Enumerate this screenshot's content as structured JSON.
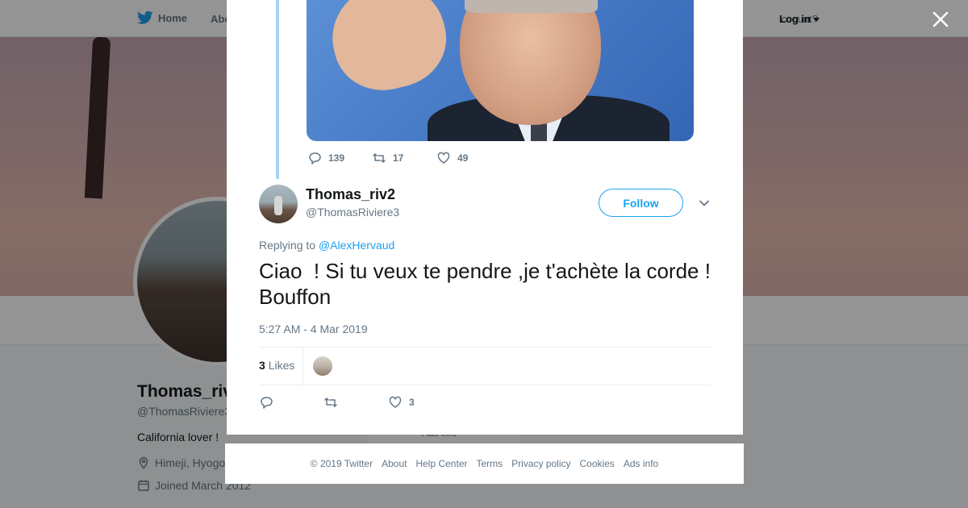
{
  "topnav": {
    "home_label": "Home",
    "about_label_partial": "Abo",
    "account_partial": "ccount?",
    "login_label": "Log in"
  },
  "background_profile": {
    "name_partial": "Thomas_riv",
    "handle_partial": "@ThomasRiviere3",
    "bio": "California lover !",
    "location_partial": "Himeji, Hyogo",
    "joined": "Joined March 2012",
    "ads_info_partial": "Ads info"
  },
  "previous_tweet": {
    "replies": "139",
    "retweets": "17",
    "likes": "49"
  },
  "tweet": {
    "author_name": "Thomas_riv2",
    "author_handle": "@ThomasRiviere3",
    "follow_label": "Follow",
    "replying_prefix": "Replying to",
    "replying_to": "@AlexHervaud",
    "text": "Ciao  ! Si tu veux te pendre ,je t'achète la corde ! Bouffon",
    "timestamp": "5:27 AM - 4 Mar 2019",
    "likes_count": "3",
    "likes_label": "Likes",
    "action_like_count": "3"
  },
  "footer": {
    "copyright": "© 2019 Twitter",
    "about": "About",
    "help": "Help Center",
    "terms": "Terms",
    "privacy": "Privacy policy",
    "cookies": "Cookies",
    "ads_info": "Ads info"
  },
  "colors": {
    "accent": "#1da1f2",
    "thread_line": "#a6d6f5",
    "secondary_text": "#657786"
  }
}
